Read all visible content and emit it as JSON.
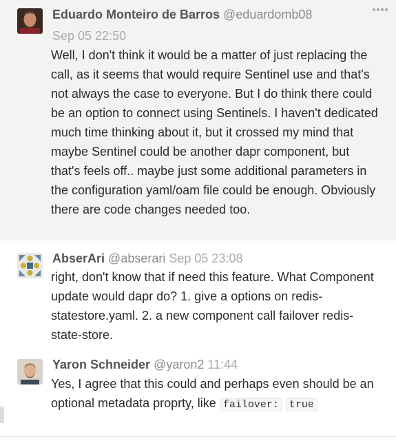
{
  "messages": [
    {
      "author": "Eduardo Monteiro de Barros",
      "handle": "@eduardomb08",
      "time": "Sep 05 22:50",
      "avatar_icon": "user-avatar-photo",
      "body": "Well, I don't think it would be a matter of just replacing the call, as it seems that would require Sentinel use and that's not always the case to everyone. But I do think there could be an option to connect using Sentinels. I haven't dedicated much time thinking about it, but it crossed my mind that maybe Sentinel could be another dapr component, but that's feels off.. maybe just some additional parameters in the configuration yaml/oam file could be enough. Obviously there are code changes needed too."
    },
    {
      "author": "AbserAri",
      "handle": "@abserari",
      "time": "Sep 05 23:08",
      "avatar_icon": "identicon-avatar",
      "body": "right, don't know that if need this feature. What Component update would dapr do? 1. give a options on redis-statestore.yaml. 2. a new component call failover redis-state-store."
    },
    {
      "author": "Yaron Schneider",
      "handle": "@yaron2",
      "time": "11:44",
      "avatar_icon": "user-avatar-photo",
      "body_prefix": "Yes, I agree that this could and perhaps even should be an optional metadata proprty, like ",
      "code_1": "failover:",
      "code_2": "true"
    }
  ],
  "colors": {
    "highlight_bg": "#f3f3f3",
    "author": "#555555",
    "handle": "#8a8a8a",
    "time": "#aaaaaa",
    "body_text": "#2b2b2b"
  }
}
